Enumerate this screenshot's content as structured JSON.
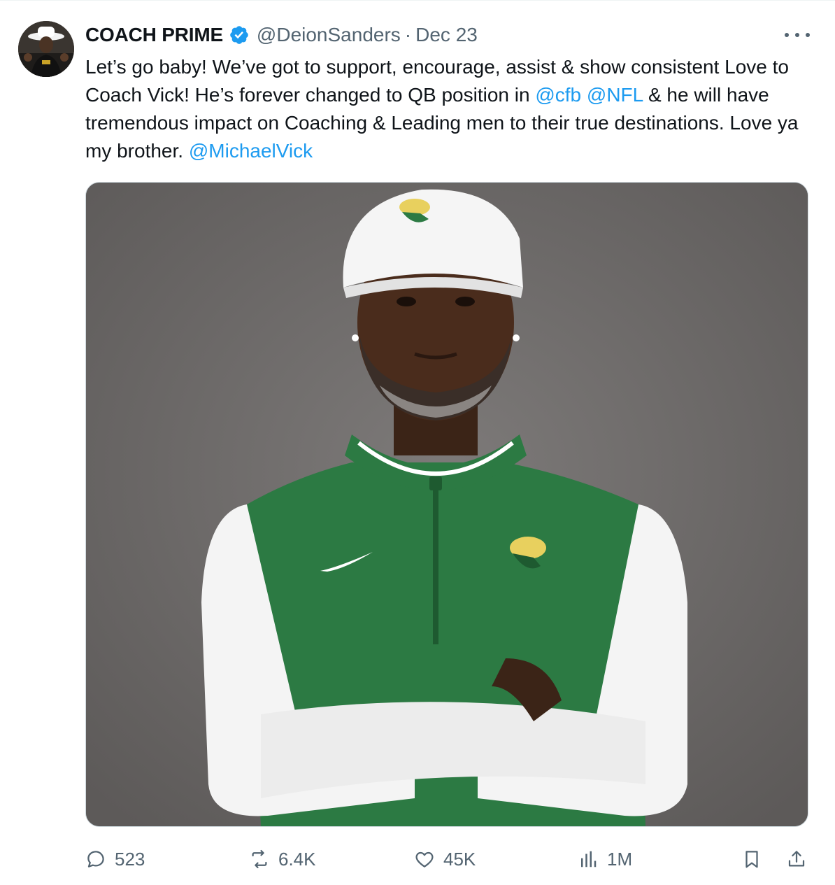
{
  "tweet": {
    "author": {
      "display_name": "COACH PRIME",
      "handle": "@DeionSanders",
      "verified": true
    },
    "separator": "·",
    "date": "Dec 23",
    "text": {
      "seg1": "Let’s go baby! We’ve got to support, encourage, assist & show consistent Love to Coach Vick! He’s forever changed to QB position in ",
      "mention1": "@cfb",
      "seg2": " ",
      "mention2": "@NFL",
      "seg3": " & he will have tremendous impact on Coaching & Leading men to their true destinations. Love ya my brother. ",
      "mention3": "@MichaelVick"
    },
    "metrics": {
      "replies": "523",
      "reposts": "6.4K",
      "likes": "45K",
      "views": "1M"
    }
  },
  "colors": {
    "text_primary": "#0f1419",
    "text_secondary": "#536471",
    "link_blue": "#1d9bf0",
    "verified_blue": "#1d9bf0",
    "media_background": "#6e6b6b",
    "jersey_green": "#2c7a43"
  },
  "icons": {
    "verified": "verified-badge-icon",
    "more": "more-dots-icon",
    "reply": "reply-bubble-icon",
    "repost": "repost-arrows-icon",
    "like": "heart-icon",
    "views": "bar-chart-icon",
    "bookmark": "bookmark-icon",
    "share": "share-upload-icon"
  }
}
